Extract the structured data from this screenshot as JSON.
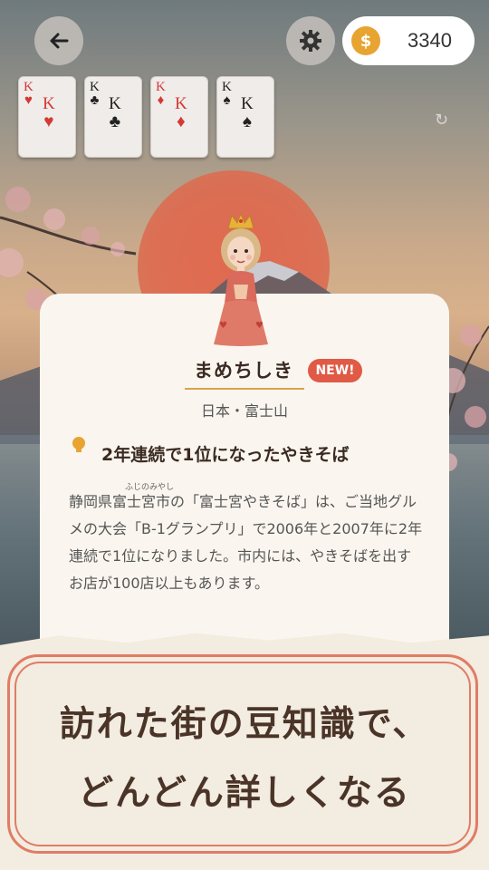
{
  "header": {
    "back_icon": "arrow-left-icon",
    "settings_icon": "gear-icon",
    "coin_symbol": "$",
    "coin_count": "3340"
  },
  "cards": [
    {
      "rank": "K",
      "suit": "♥",
      "color": "red"
    },
    {
      "rank": "K",
      "suit": "♣",
      "color": "black"
    },
    {
      "rank": "K",
      "suit": "♦",
      "color": "red"
    },
    {
      "rank": "K",
      "suit": "♠",
      "color": "black"
    }
  ],
  "refresh_icon": "↻",
  "character": {
    "name": "まめちしき",
    "badge": "NEW!"
  },
  "location": "日本・富士山",
  "fact": {
    "title": "2年連続で1位になったやきそば",
    "ruby": "ふじのみやし",
    "body": "静岡県富士宮市の「富士宮やきそば」は、ご当地グルメの大会「B-1グランプリ」で2006年と2007年に2年連続で1位になりました。市内には、やきそばを出すお店が100店以上もあります。"
  },
  "banner": {
    "line1": "訪れた街の豆知識で、",
    "line2": "どんどん詳しくなる"
  },
  "colors": {
    "accent": "#e05a46",
    "coin": "#e8a431",
    "frame": "#e07c66"
  }
}
